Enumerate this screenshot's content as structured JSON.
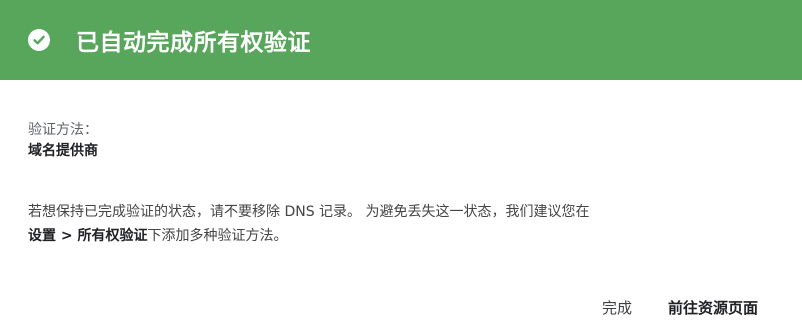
{
  "header": {
    "icon": "check-circle-icon",
    "title": "已自动完成所有权验证",
    "bg_color": "#58a55c"
  },
  "method": {
    "label": "验证方法：",
    "value": "域名提供商"
  },
  "info": {
    "part1": "若想保持已完成验证的状态，请不要移除 DNS 记录。 为避免丢失这一状态，我们建议您在",
    "link": "设置 > 所有权验证",
    "part2": "下添加多种验证方法。"
  },
  "actions": {
    "done_label": "完成",
    "goto_label": "前往资源页面"
  }
}
